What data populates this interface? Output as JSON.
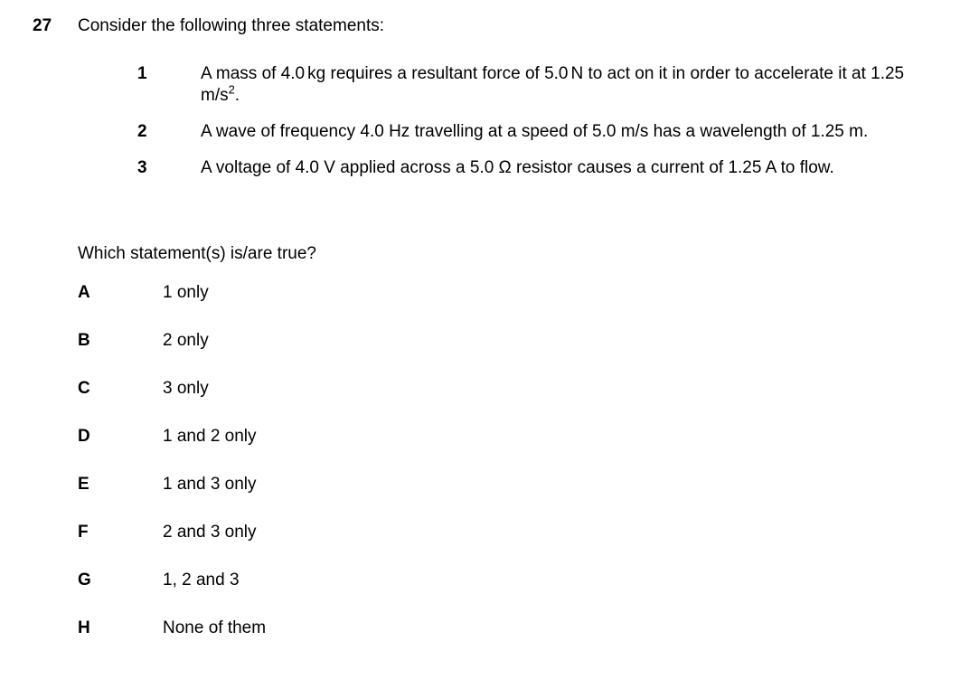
{
  "question": {
    "number": "27",
    "stem": "Consider the following three statements:",
    "statements": [
      {
        "number": "1",
        "text_parts": [
          "A mass of 4.0",
          "kg requires a resultant force of 5.0",
          "N to act on it in order to accelerate it at 1.25",
          "m/s"
        ],
        "superscript": "2",
        "trailing": ".",
        "full_text": "A mass of 4.0 kg requires a resultant force of 5.0 N to act on it in order to accelerate it at 1.25 m/s2."
      },
      {
        "number": "2",
        "full_text": "A wave of frequency 4.0 Hz travelling at a speed of 5.0 m/s has a wavelength of 1.25 m."
      },
      {
        "number": "3",
        "full_text": "A voltage of 4.0 V applied across a 5.0 Ω resistor causes a current of 1.25 A to flow."
      }
    ],
    "lead_in": "Which statement(s) is/are true?",
    "options": [
      {
        "letter": "A",
        "text": "1 only"
      },
      {
        "letter": "B",
        "text": "2 only"
      },
      {
        "letter": "C",
        "text": "3 only"
      },
      {
        "letter": "D",
        "text": "1 and 2 only"
      },
      {
        "letter": "E",
        "text": "1 and 3 only"
      },
      {
        "letter": "F",
        "text": "2 and 3 only"
      },
      {
        "letter": "G",
        "text": "1, 2 and 3"
      },
      {
        "letter": "H",
        "text": "None of them"
      }
    ]
  },
  "colors": {
    "text": "#000000",
    "background": "#ffffff"
  }
}
